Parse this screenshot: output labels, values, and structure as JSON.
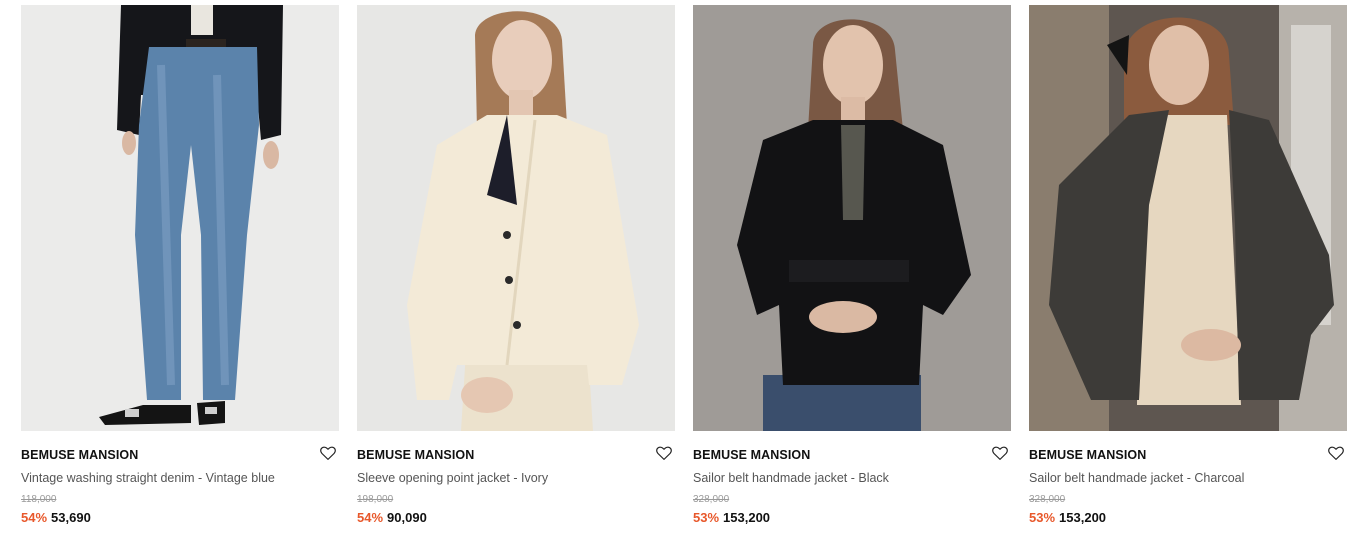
{
  "colors": {
    "discount": "#e8582b",
    "brand_text": "#111111",
    "name_text": "#555555",
    "original_price": "#9a9a9a"
  },
  "wishlist_icon": "heart-outline-icon",
  "products": [
    {
      "brand": "BEMUSE MANSION",
      "name": "Vintage washing straight denim - Vintage blue",
      "original_price": "118,000",
      "discount": "54%",
      "price": "53,690"
    },
    {
      "brand": "BEMUSE MANSION",
      "name": "Sleeve opening point jacket - Ivory",
      "original_price": "198,000",
      "discount": "54%",
      "price": "90,090"
    },
    {
      "brand": "BEMUSE MANSION",
      "name": "Sailor belt handmade jacket - Black",
      "original_price": "328,000",
      "discount": "53%",
      "price": "153,200"
    },
    {
      "brand": "BEMUSE MANSION",
      "name": "Sailor belt handmade jacket - Charcoal",
      "original_price": "328,000",
      "discount": "53%",
      "price": "153,200"
    }
  ]
}
